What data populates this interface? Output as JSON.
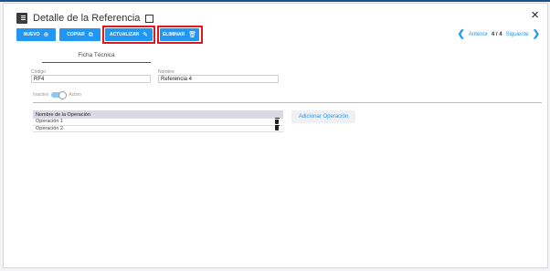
{
  "header": {
    "title": "Detalle de la Referencia",
    "icons": {
      "document": "document-icon",
      "window": "window-icon",
      "close": "close-icon"
    },
    "close_label": "×"
  },
  "toolbar": {
    "buttons": [
      {
        "label": "NUEVO",
        "icon": "plus-circle-icon",
        "glyph": "⊕"
      },
      {
        "label": "COPIAR",
        "icon": "copy-icon",
        "glyph": "⧉"
      },
      {
        "label": "ACTUALIZAR",
        "icon": "pencil-icon",
        "glyph": "✎"
      },
      {
        "label": "ELIMINAR",
        "icon": "trash-icon",
        "glyph": "🗑"
      }
    ],
    "accent": "#2196f3",
    "highlight_color": "#e0181e"
  },
  "pager": {
    "prev_label": "Anterior",
    "next_label": "Siguiente",
    "count": "4 / 4",
    "prev_glyph": "❮",
    "next_glyph": "❯"
  },
  "tabs": [
    {
      "label": "Ficha Técnica",
      "active": true
    }
  ],
  "form": {
    "codigo": {
      "label": "Código",
      "value": "RF4"
    },
    "nombre": {
      "label": "Nombre",
      "value": "Referencia 4"
    },
    "estado": {
      "off_label": "Inactivo",
      "on_label": "Activo",
      "active": true
    }
  },
  "operations": {
    "header": "Nombre de la Operación",
    "rows": [
      "Operación 1",
      "Operación 2"
    ],
    "add_label": "Adicionar Operación"
  }
}
